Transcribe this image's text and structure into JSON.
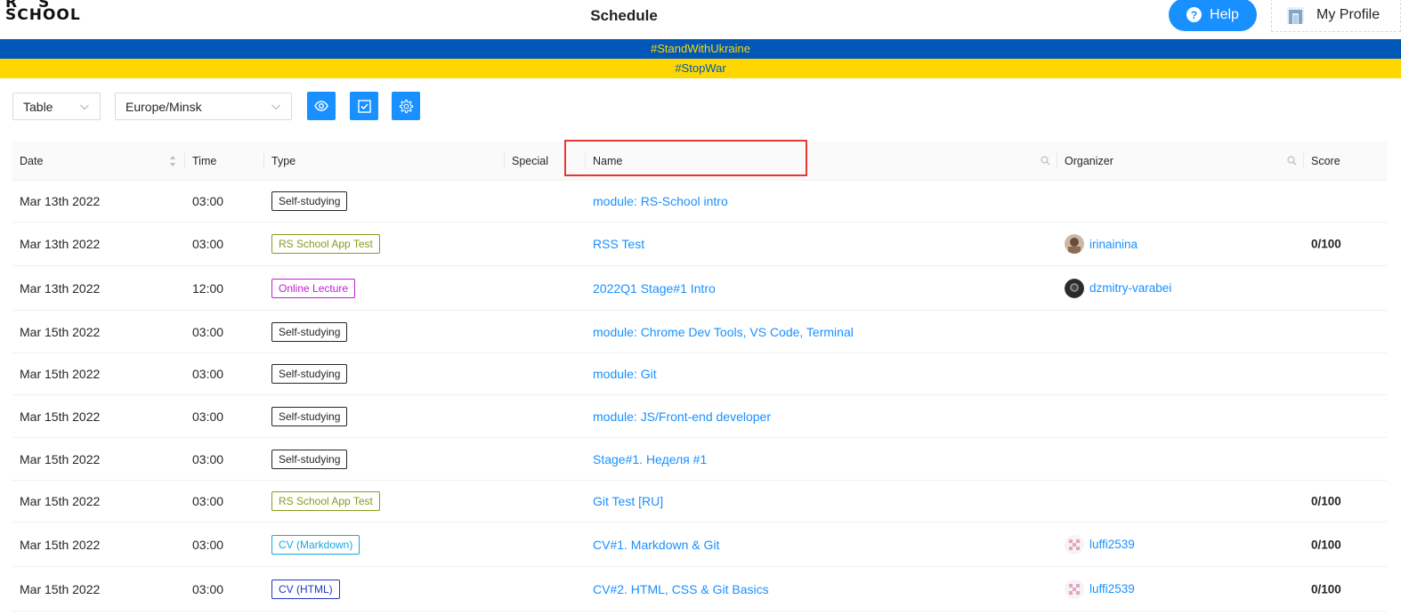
{
  "header": {
    "logo_line1": "R S",
    "logo_line2": "SCHOOL",
    "title": "Schedule",
    "help_label": "Help",
    "profile_label": "My Profile"
  },
  "banners": {
    "blue": "#StandWithUkraine",
    "yellow": "#StopWar"
  },
  "toolbar": {
    "view_select": "Table",
    "timezone_select": "Europe/Minsk",
    "buttons": [
      "eye-icon",
      "check-square-icon",
      "gear-icon"
    ]
  },
  "colors": {
    "primary": "#1890ff",
    "ukraine_blue": "#0057b7",
    "ukraine_yellow": "#ffd700",
    "highlight": "#e53935"
  },
  "table": {
    "columns": [
      "Date",
      "Time",
      "Type",
      "Special",
      "Name",
      "Organizer",
      "Score"
    ],
    "rows": [
      {
        "date": "Mar 13th 2022",
        "time": "03:00",
        "type": "Self-studying",
        "type_color": "#262626",
        "name": "module: RS-School intro",
        "organizer": "",
        "score": ""
      },
      {
        "date": "Mar 13th 2022",
        "time": "03:00",
        "type": "RS School App Test",
        "type_color": "#8a9a1f",
        "name": "RSS Test",
        "organizer": "irinainina",
        "score": "0/100"
      },
      {
        "date": "Mar 13th 2022",
        "time": "12:00",
        "type": "Online Lecture",
        "type_color": "#c41dd4",
        "name": "2022Q1 Stage#1 Intro",
        "organizer": "dzmitry-varabei",
        "score": ""
      },
      {
        "date": "Mar 15th 2022",
        "time": "03:00",
        "type": "Self-studying",
        "type_color": "#262626",
        "name": "module: Chrome Dev Tools, VS Code, Terminal",
        "organizer": "",
        "score": ""
      },
      {
        "date": "Mar 15th 2022",
        "time": "03:00",
        "type": "Self-studying",
        "type_color": "#262626",
        "name": "module: Git",
        "organizer": "",
        "score": ""
      },
      {
        "date": "Mar 15th 2022",
        "time": "03:00",
        "type": "Self-studying",
        "type_color": "#262626",
        "name": "module: JS/Front-end developer",
        "organizer": "",
        "score": ""
      },
      {
        "date": "Mar 15th 2022",
        "time": "03:00",
        "type": "Self-studying",
        "type_color": "#262626",
        "name": "Stage#1. Неделя #1",
        "organizer": "",
        "score": ""
      },
      {
        "date": "Mar 15th 2022",
        "time": "03:00",
        "type": "RS School App Test",
        "type_color": "#8a9a1f",
        "name": "Git Test [RU]",
        "organizer": "",
        "score": "0/100"
      },
      {
        "date": "Mar 15th 2022",
        "time": "03:00",
        "type": "CV (Markdown)",
        "type_color": "#13a8e6",
        "name": "CV#1. Markdown & Git",
        "organizer": "luffi2539",
        "score": "0/100"
      },
      {
        "date": "Mar 15th 2022",
        "time": "03:00",
        "type": "CV (HTML)",
        "type_color": "#1d39c4",
        "name": "CV#2. HTML, CSS & Git Basics",
        "organizer": "luffi2539",
        "score": "0/100"
      }
    ]
  }
}
